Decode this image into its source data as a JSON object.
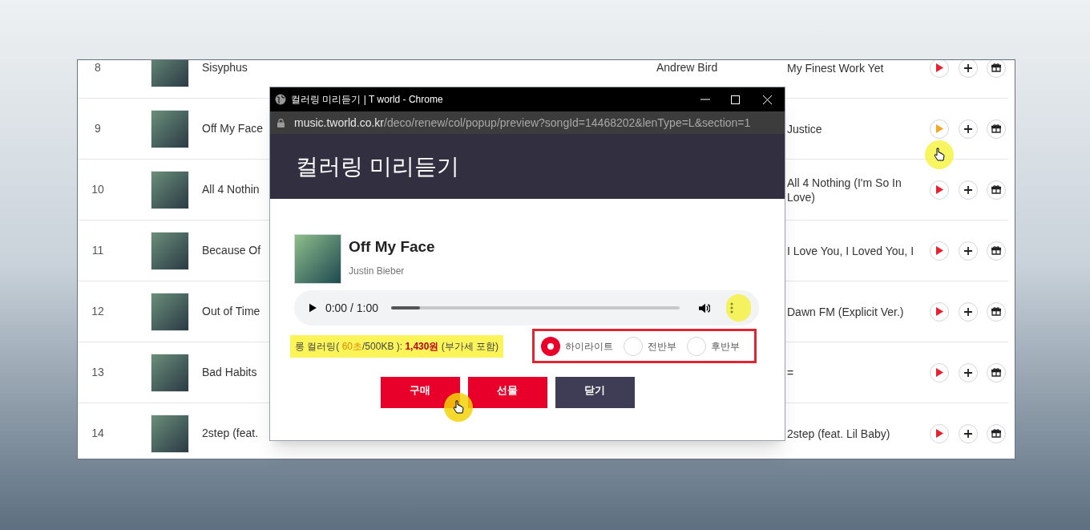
{
  "list": {
    "rows": [
      {
        "rank": "8",
        "title": "Sisyphus",
        "artist": "Andrew Bird",
        "album": "My Finest Work Yet",
        "play_hovered": false
      },
      {
        "rank": "9",
        "title": "Off My Face",
        "album": "Justice",
        "play_hovered": true
      },
      {
        "rank": "10",
        "title": "All 4 Nothin",
        "album": "All 4 Nothing (I'm So In Love)",
        "play_hovered": false
      },
      {
        "rank": "11",
        "title": "Because Of",
        "album": "I Love You, I Loved You, I",
        "play_hovered": false
      },
      {
        "rank": "12",
        "title": "Out of Time",
        "album": "Dawn FM (Explicit Ver.)",
        "play_hovered": false
      },
      {
        "rank": "13",
        "title": "Bad Habits",
        "album": "=",
        "play_hovered": false
      },
      {
        "rank": "14",
        "title": "2step (feat.",
        "album": "2step (feat. Lil Baby)",
        "play_hovered": false
      }
    ]
  },
  "popup": {
    "window_title": "컬러링 미리듣기 | T world - Chrome",
    "url_host": "music.tworld.co.kr",
    "url_path": "/deco/renew/col/popup/preview?songId=14468202&lenType=L&section=1",
    "heading": "컬러링 미리듣기",
    "song_title": "Off My Face",
    "artist": "Justin Bieber",
    "player": {
      "time": "0:00 / 1:00",
      "level": 0.1
    },
    "price_parts": [
      {
        "text": "롱 컬러링( ",
        "kind": "plain"
      },
      {
        "text": "60초",
        "kind": "accent"
      },
      {
        "text": "/500KB ): ",
        "kind": "plain"
      },
      {
        "text": "1,430원",
        "kind": "price"
      },
      {
        "text": " (부가세 포함)",
        "kind": "plain"
      }
    ],
    "sections": [
      {
        "label": "하이라이트",
        "selected": true
      },
      {
        "label": "전반부",
        "selected": false
      },
      {
        "label": "후반부",
        "selected": false
      }
    ],
    "buttons": [
      {
        "label": "구매",
        "kind": "primary"
      },
      {
        "label": "선물",
        "kind": "primary"
      },
      {
        "label": "닫기",
        "kind": "dark"
      }
    ]
  }
}
